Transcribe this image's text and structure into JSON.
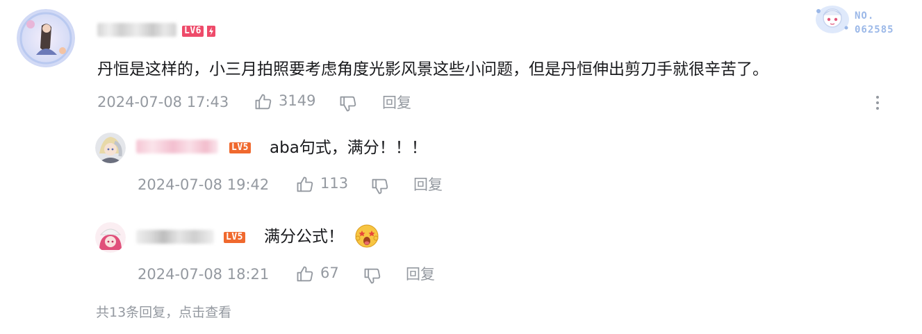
{
  "colors": {
    "level_badge": "#f0692e",
    "level_badge_main": "#ee4b6a",
    "meta_text": "#9499a0",
    "text": "#18191c",
    "badge_no": "#9bb8e8"
  },
  "main_comment": {
    "level": "LV6",
    "text": "丹恒是这样的，小三月拍照要考虑角度光影风景这些小问题，但是丹恒伸出剪刀手就很辛苦了。",
    "time": "2024-07-08 17:43",
    "likes": "3149",
    "reply_label": "回复",
    "fan_badge": {
      "label": "NO.",
      "number": "062585"
    }
  },
  "replies": [
    {
      "level": "LV5",
      "text": "aba句式，满分！！！",
      "time": "2024-07-08 19:42",
      "likes": "113",
      "reply_label": "回复"
    },
    {
      "level": "LV5",
      "text": "满分公式！",
      "emoji": "star-eyes-emoji",
      "time": "2024-07-08 18:21",
      "likes": "67",
      "reply_label": "回复"
    }
  ],
  "view_more": "共13条回复，点击查看",
  "icons": {
    "like": "thumbs-up-icon",
    "dislike": "thumbs-down-icon",
    "more": "vertical-dots-icon"
  }
}
